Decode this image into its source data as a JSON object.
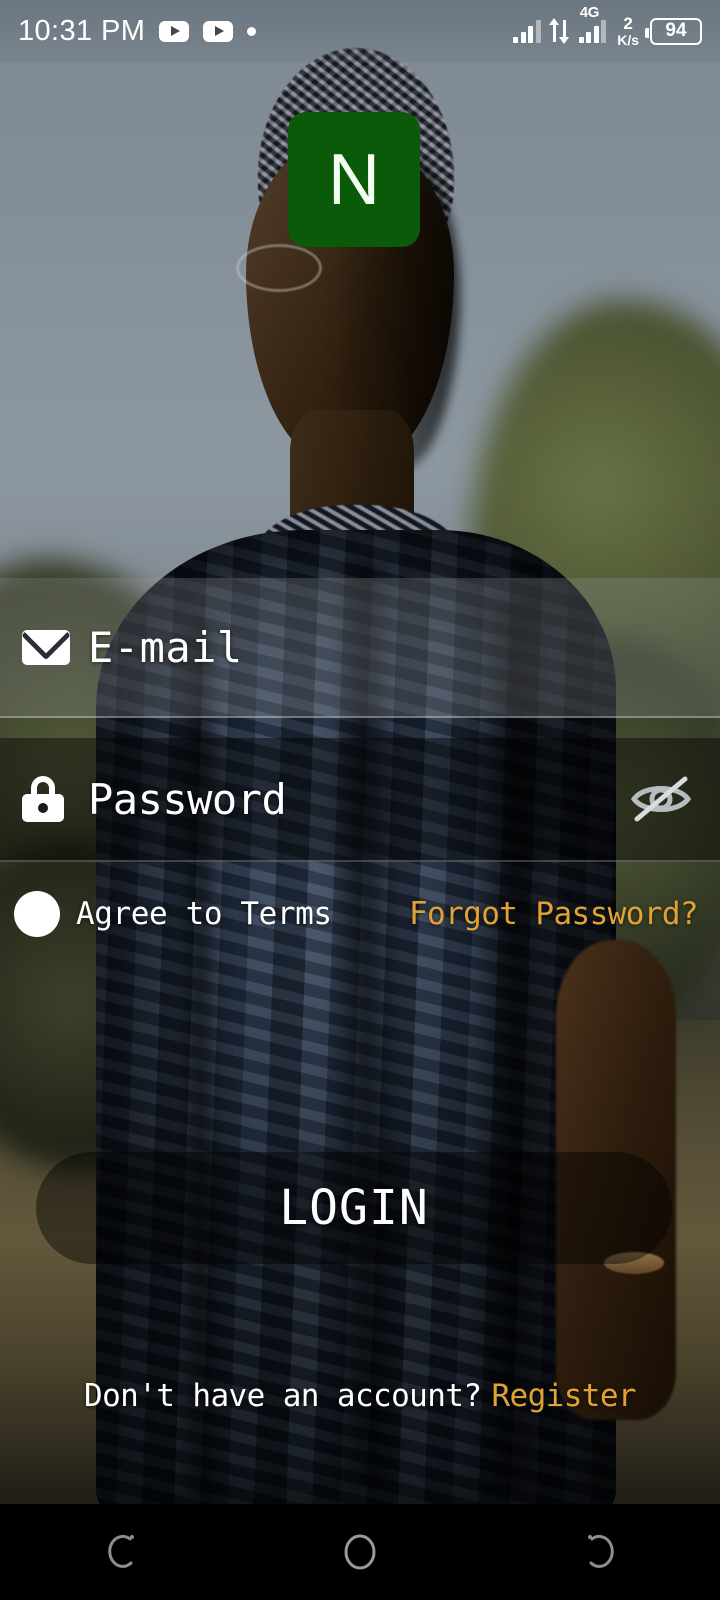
{
  "statusbar": {
    "clock": "10:31 PM",
    "notification_icons": [
      "youtube-icon",
      "youtube-icon",
      "dot-icon"
    ],
    "network_type": "4G",
    "data_speed_value": "2",
    "data_speed_unit": "K/s",
    "battery_level": "94",
    "signal_icon": "signal-bars-icon",
    "data_transfer_icon": "data-transfer-arrows-icon"
  },
  "brand": {
    "logo_letter": "N",
    "logo_color": "#0a5a0a",
    "logo_text_color": "#f2fff2"
  },
  "form": {
    "email": {
      "placeholder": "E-mail",
      "value": "",
      "icon": "envelope-icon"
    },
    "password": {
      "placeholder": "Password",
      "value": "",
      "icon": "lock-icon",
      "visibility_toggle_icon": "eye-off-icon",
      "visibility_state": "hidden"
    },
    "terms": {
      "label": "Agree to Terms",
      "checked": false
    },
    "forgot_password_label": "Forgot Password?",
    "submit_label": "LOGIN"
  },
  "register": {
    "prompt": "Don't have an account?",
    "link_label": "Register"
  },
  "navbar": {
    "buttons": [
      {
        "name": "recents-button",
        "icon": "recents-icon"
      },
      {
        "name": "home-button",
        "icon": "home-circle-icon"
      },
      {
        "name": "back-button",
        "icon": "back-icon"
      }
    ]
  },
  "colors": {
    "accent": "#e0a233",
    "brand_green": "#0a5a0a",
    "text_primary": "#ffffff",
    "navbar_background": "#000000"
  }
}
